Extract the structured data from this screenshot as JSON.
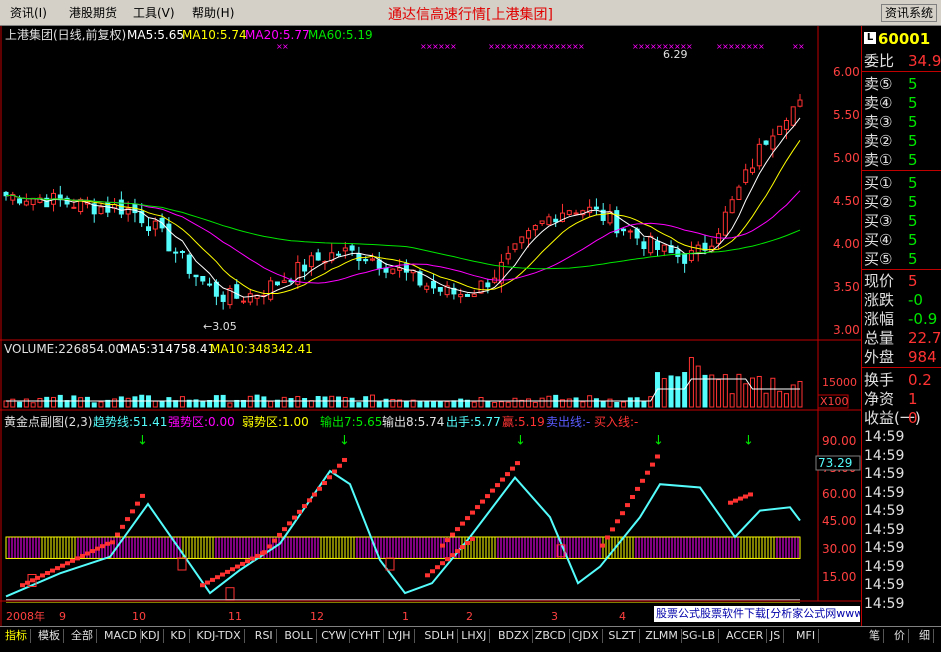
{
  "menu": {
    "items": [
      "资讯(I)",
      "港股期货",
      "工具(V)",
      "帮助(H)"
    ],
    "title": "通达信高速行情[上港集团]",
    "right_button": "资讯系统"
  },
  "main_header": {
    "name": "上港集团(日线,前复权)",
    "ma5": "MA5:5.65",
    "ma10": "MA10:5.74",
    "ma20": "MA20:5.77",
    "ma60": "MA60:5.19"
  },
  "price_axis": [
    "6.00",
    "5.50",
    "5.00",
    "4.50",
    "4.00",
    "3.50",
    "3.00"
  ],
  "annotations": {
    "high": "6.29",
    "low": "←3.05"
  },
  "volume_header": {
    "volume": "VOLUME:226854.00",
    "ma5": "MA5:314758.41",
    "ma10": "MA10:348342.41"
  },
  "volume_axis": [
    "15000"
  ],
  "volume_unit": "X100",
  "indicator_header": {
    "name": "黄金点副图(2,3)",
    "trend": "趋势线:51.41",
    "strong": "强势区:0.00",
    "weak": "弱势区:1.00",
    "out7": "输出7:5.65",
    "out8": "输出8:5.74",
    "hand": "出手:5.77",
    "win": "赢:5.19",
    "sell": "卖出线:-",
    "buy": "买入线:-"
  },
  "indicator_axis": [
    "90.00",
    "75.00",
    "60.00",
    "45.00",
    "30.00",
    "15.00"
  ],
  "indicator_value": "73.29",
  "date_axis": [
    "2008年",
    "9",
    "10",
    "11",
    "12",
    "1",
    "2",
    "3",
    "4"
  ],
  "colors": {
    "up": "#ff3232",
    "down": "#54fcfc",
    "ma5": "#ffffff",
    "ma10": "#ffff00",
    "ma20": "#ff00ff",
    "ma60": "#00e600",
    "frame": "#c00000"
  },
  "chart_data": {
    "type": "candlestick",
    "x": [
      "2008-09",
      "2008-10",
      "2008-11",
      "2008-12",
      "2009-01",
      "2009-02",
      "2009-03",
      "2009-04"
    ],
    "close_trend": [
      4.6,
      4.45,
      3.35,
      3.9,
      3.4,
      4.45,
      3.85,
      5.7
    ],
    "ylim": [
      2.95,
      6.35
    ],
    "high": 6.29,
    "low": 3.05
  },
  "side": {
    "code": "60001",
    "rows": [
      {
        "label": "委比",
        "value": "34.9"
      },
      {
        "label": "卖⑤",
        "value": "5"
      },
      {
        "label": "卖④",
        "value": "5"
      },
      {
        "label": "卖③",
        "value": "5"
      },
      {
        "label": "卖②",
        "value": "5"
      },
      {
        "label": "卖①",
        "value": "5"
      },
      {
        "label": "买①",
        "value": "5"
      },
      {
        "label": "买②",
        "value": "5"
      },
      {
        "label": "买③",
        "value": "5"
      },
      {
        "label": "买④",
        "value": "5"
      },
      {
        "label": "买⑤",
        "value": "5"
      },
      {
        "label": "现价",
        "value": "5"
      },
      {
        "label": "涨跌",
        "value": "-0"
      },
      {
        "label": "涨幅",
        "value": "-0.9"
      },
      {
        "label": "总量",
        "value": "22.7"
      },
      {
        "label": "外盘",
        "value": "984"
      },
      {
        "label": "换手",
        "value": "0.2"
      },
      {
        "label": "净资",
        "value": "1"
      },
      {
        "label": "收益(一)",
        "value": "0"
      }
    ],
    "times": [
      "14:59",
      "14:59",
      "14:59",
      "14:59",
      "14:59",
      "14:59",
      "14:59",
      "14:59",
      "14:59",
      "14:59"
    ]
  },
  "ad_text": "股票公式股票软件下载[分析家公式网www.88gs.com]",
  "bottom_tabs": [
    "指标",
    "模板",
    "全部",
    "MACD",
    "KDJ",
    "KD",
    "KDJ-TDX",
    "RSI",
    "BOLL",
    "CYW",
    "CYHT",
    "LYJH",
    "SDLH",
    "LHXJ",
    "BDZX",
    "ZBCD",
    "CJDX",
    "SLZT",
    "ZLMM",
    "SG-LB",
    "ACCER",
    "JS",
    "MFI"
  ],
  "bottom_right_tabs": [
    "笔",
    "价",
    "细"
  ]
}
